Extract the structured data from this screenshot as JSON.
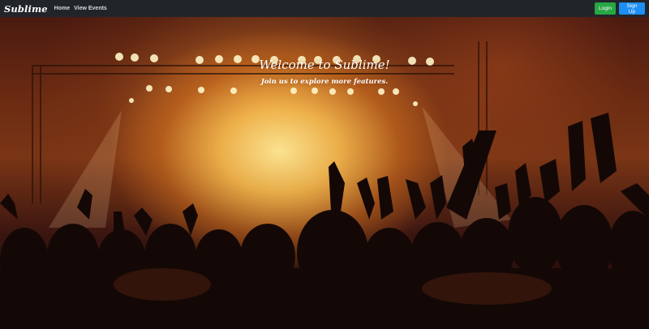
{
  "navbar": {
    "brand": "Sublime",
    "links": [
      "Home",
      "View Events"
    ],
    "login_label": "Login",
    "signup_label": "Sign Up"
  },
  "hero": {
    "title": "Welcome to Sublime!",
    "subtitle": "Join us to explore more features."
  },
  "colors": {
    "navbar_bg": "#212529",
    "login_button": "#28a745",
    "signup_button": "#1e8ef2"
  }
}
